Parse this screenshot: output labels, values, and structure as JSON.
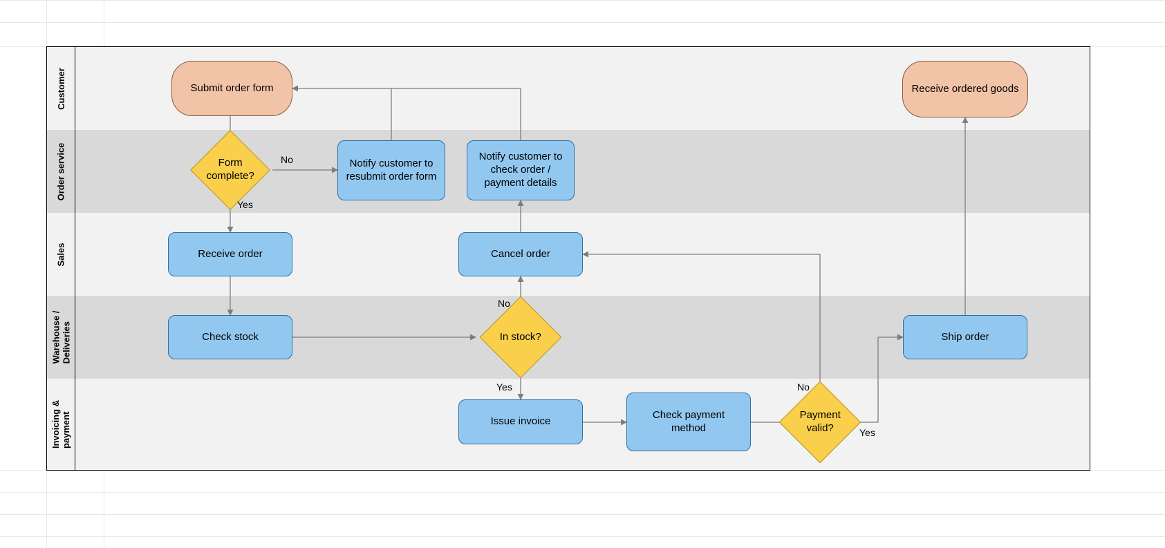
{
  "lanes": {
    "customer": "Customer",
    "order_service": "Order service",
    "sales": "Sales",
    "warehouse": "Warehouse /\nDeliveries",
    "invoicing": "Invoicing &\npayment"
  },
  "nodes": {
    "submit_order": "Submit order form",
    "receive_goods": "Receive ordered goods",
    "form_complete": "Form complete?",
    "notify_resubmit": "Notify customer to resubmit order form",
    "notify_check": "Notify customer to check order / payment details",
    "receive_order": "Receive order",
    "cancel_order": "Cancel order",
    "check_stock": "Check stock",
    "in_stock": "In stock?",
    "ship_order": "Ship order",
    "issue_invoice": "Issue invoice",
    "check_payment": "Check payment method",
    "payment_valid": "Payment valid?"
  },
  "labels": {
    "yes": "Yes",
    "no": "No"
  },
  "colors": {
    "lane_light": "#f2f2f2",
    "lane_dark": "#d9d9d9",
    "terminator_fill": "#f2c4a7",
    "process_fill": "#92c8f0",
    "decision_fill": "#f9cf4b",
    "connector": "#7d7d7d"
  }
}
